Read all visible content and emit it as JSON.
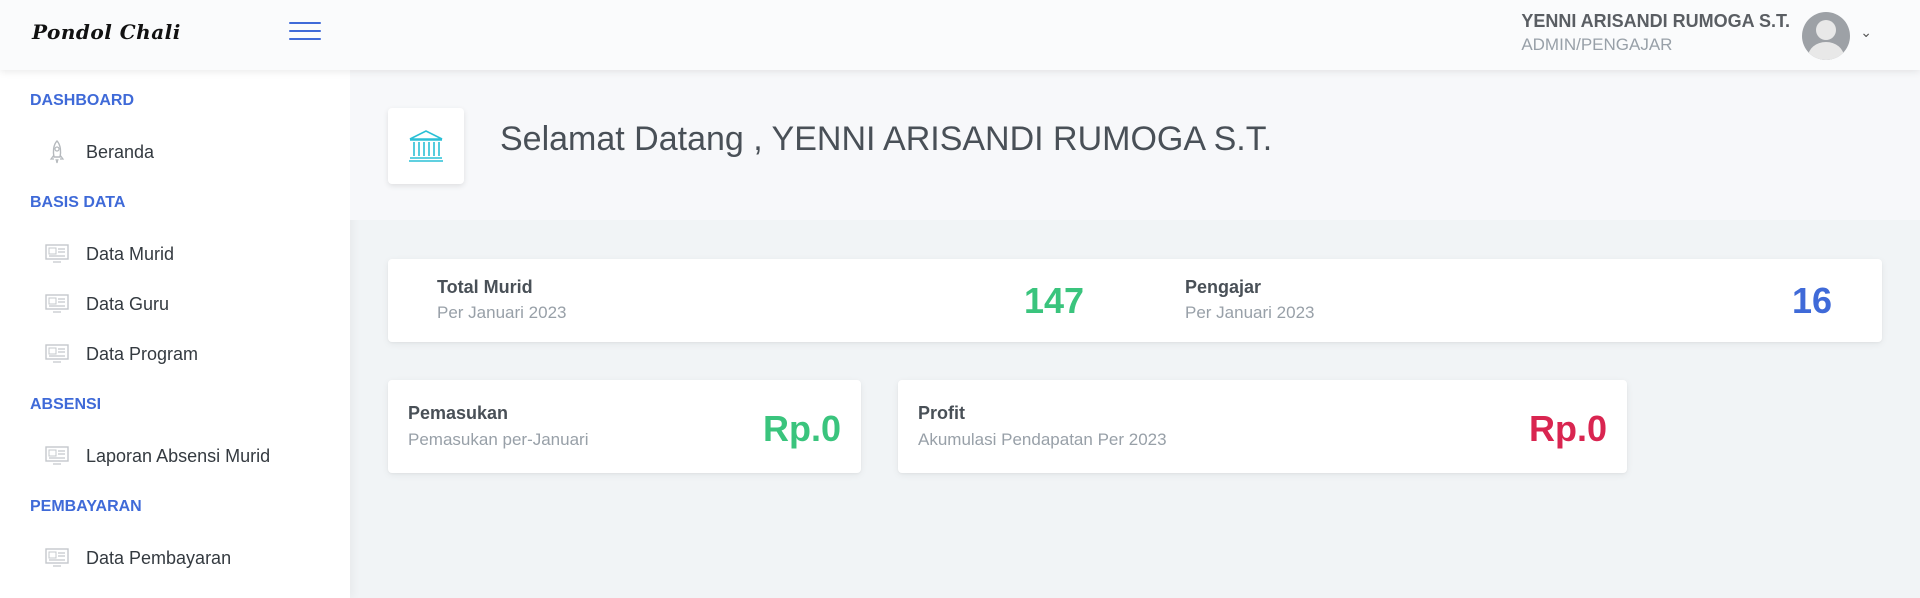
{
  "header": {
    "logo": "Pondol Chali",
    "user_name": "YENNI ARISANDI RUMOGA S.T.",
    "user_role": "ADMIN/PENGAJAR"
  },
  "sidebar": {
    "sections": [
      {
        "heading": "DASHBOARD",
        "items": [
          {
            "label": "Beranda",
            "icon": "rocket-icon"
          }
        ]
      },
      {
        "heading": "BASIS DATA",
        "items": [
          {
            "label": "Data Murid",
            "icon": "monitor-icon"
          },
          {
            "label": "Data Guru",
            "icon": "monitor-icon"
          },
          {
            "label": "Data Program",
            "icon": "monitor-icon"
          }
        ]
      },
      {
        "heading": "ABSENSI",
        "items": [
          {
            "label": "Laporan Absensi Murid",
            "icon": "monitor-icon"
          }
        ]
      },
      {
        "heading": "PEMBAYARAN",
        "items": [
          {
            "label": "Data Pembayaran",
            "icon": "monitor-icon"
          }
        ]
      }
    ]
  },
  "main": {
    "title": "Selamat Datang , YENNI ARISANDI RUMOGA S.T.",
    "title_icon": "bank-icon",
    "stats": {
      "murid": {
        "title": "Total Murid",
        "sub": "Per Januari 2023",
        "value": "147"
      },
      "pengajar": {
        "title": "Pengajar",
        "sub": "Per Januari 2023",
        "value": "16"
      }
    },
    "pemasukan": {
      "title": "Pemasukan",
      "sub": "Pemasukan per-Januari",
      "value": "Rp.0"
    },
    "profit": {
      "title": "Profit",
      "sub": "Akumulasi Pendapatan Per 2023",
      "value": "Rp.0"
    }
  },
  "colors": {
    "accent": "#3f6ad8",
    "green": "#3ac47d",
    "red": "#d92550",
    "teal": "#16aaff"
  }
}
